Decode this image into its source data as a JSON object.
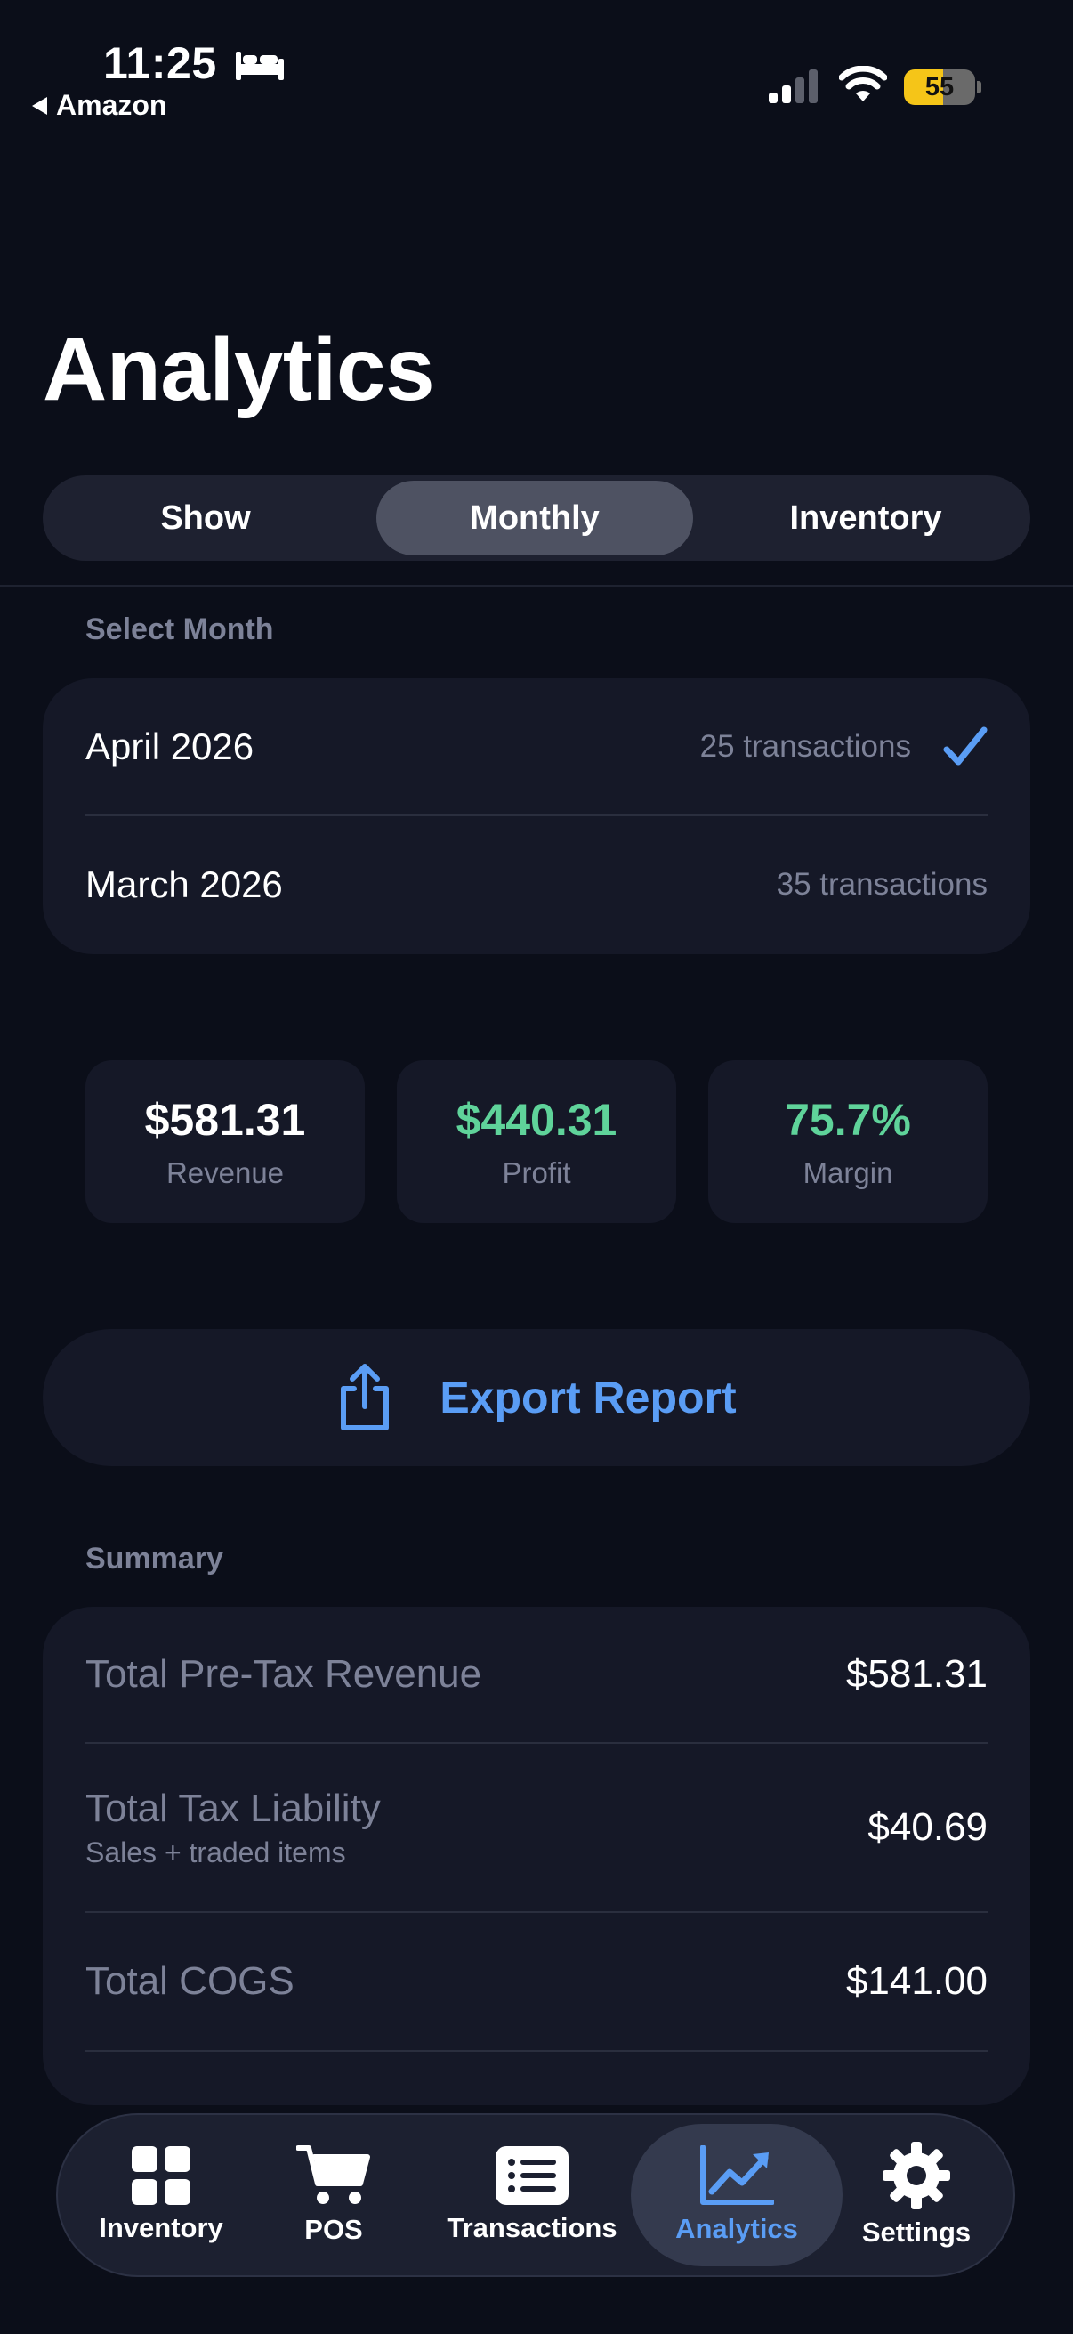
{
  "status_bar": {
    "time": "11:25",
    "back_app": "Amazon",
    "battery": "55"
  },
  "header": {
    "title": "Analytics"
  },
  "segments": [
    {
      "label": "Show",
      "selected": false
    },
    {
      "label": "Monthly",
      "selected": true
    },
    {
      "label": "Inventory",
      "selected": false
    }
  ],
  "months": {
    "section_label": "Select Month",
    "items": [
      {
        "name": "April 2026",
        "transactions": "25 transactions",
        "selected": true
      },
      {
        "name": "March 2026",
        "transactions": "35 transactions",
        "selected": false
      }
    ]
  },
  "stats": [
    {
      "value": "$581.31",
      "label": "Revenue"
    },
    {
      "value": "$440.31",
      "label": "Profit"
    },
    {
      "value": "75.7%",
      "label": "Margin"
    }
  ],
  "export": {
    "label": "Export Report"
  },
  "summary": {
    "section_label": "Summary",
    "rows": [
      {
        "label": "Total Pre-Tax Revenue",
        "sub": "",
        "value": "$581.31"
      },
      {
        "label": "Total Tax Liability",
        "sub": "Sales + traded items",
        "value": "$40.69"
      },
      {
        "label": "Total COGS",
        "sub": "",
        "value": "$141.00"
      }
    ]
  },
  "tab_bar": {
    "items": [
      {
        "label": "Inventory",
        "icon": "grid-icon",
        "active": false
      },
      {
        "label": "POS",
        "icon": "cart-icon",
        "active": false
      },
      {
        "label": "Transactions",
        "icon": "list-icon",
        "active": false
      },
      {
        "label": "Analytics",
        "icon": "chart-icon",
        "active": true
      },
      {
        "label": "Settings",
        "icon": "gear-icon",
        "active": false
      }
    ]
  },
  "colors": {
    "background": "#0b0e19",
    "card": "#151827",
    "accent_blue": "#5a9df5",
    "accent_green": "#5fd39a",
    "muted_text": "#7d8298"
  }
}
